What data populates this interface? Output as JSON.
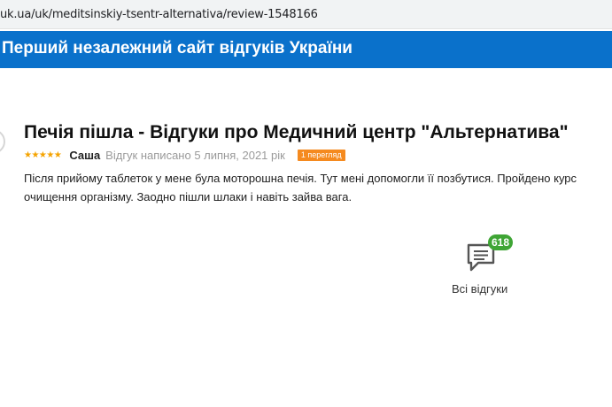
{
  "browser": {
    "url": "uk.ua/uk/meditsinskiy-tsentr-alternativa/review-1548166"
  },
  "site": {
    "header_title": "Перший незалежний сайт відгуків України",
    "header_color": "#0a71cb"
  },
  "review": {
    "title": "Печія пішла - Відгуки про Медичний центр \"Альтернатива\"",
    "stars": "★★★★★",
    "rating": 5,
    "author": "Саша",
    "written": "Відгук написано 5 липня, 2021 рік",
    "views_badge": "1 перегляд",
    "text_lines": [
      "Після прийому таблеток у мене була моторошна печія. Тут мені допомогли її позбутися. Пройдено курс",
      "очищення організму. Заодно пішли шлаки і навіть зайва вага."
    ],
    "star_color": "#f5a300",
    "badge_color": "#f58a1f"
  },
  "all_reviews": {
    "count": "618",
    "label": "Всі відгуки",
    "icon": "chat-bubble-icon",
    "badge_color": "#3fa535"
  }
}
